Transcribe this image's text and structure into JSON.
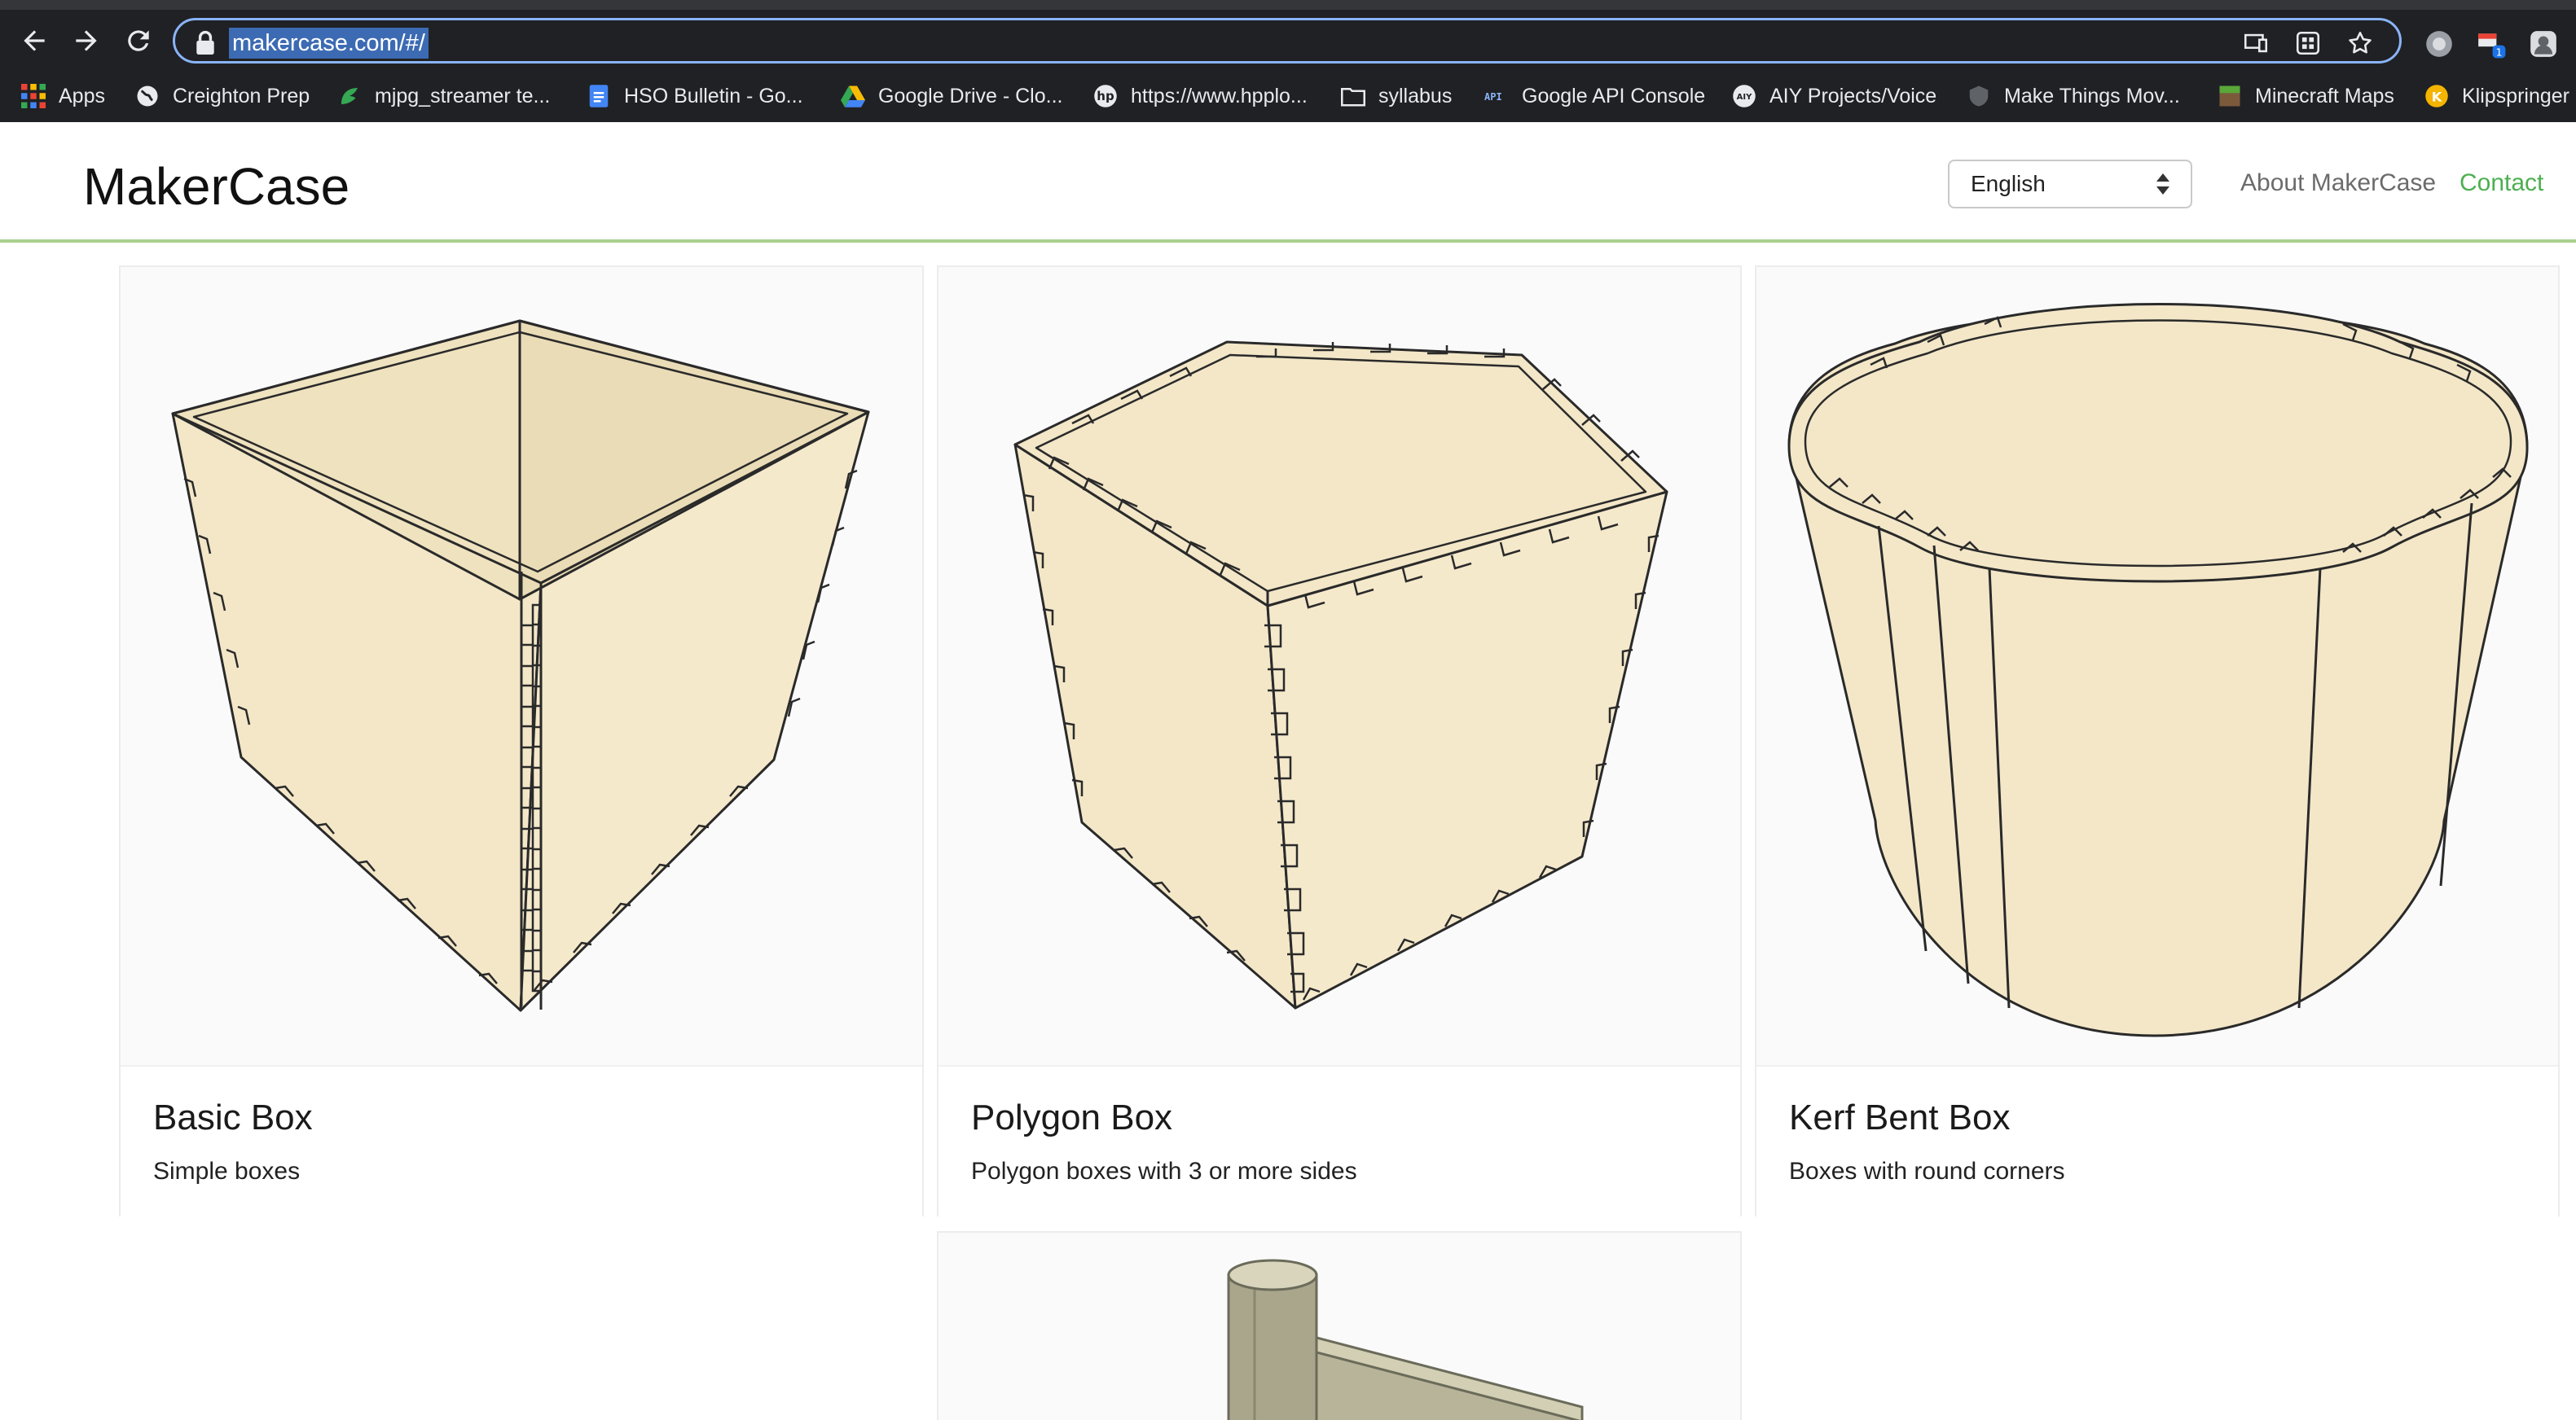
{
  "browser": {
    "url": "makercase.com/#/",
    "bookmarks": [
      {
        "label": "Apps",
        "icon": "apps-grid-icon"
      },
      {
        "label": "Creighton Prep",
        "icon": "globe-icon"
      },
      {
        "label": "mjpg_streamer te...",
        "icon": "leaf-icon"
      },
      {
        "label": "HSO Bulletin - Go...",
        "icon": "docs-icon"
      },
      {
        "label": "Google Drive - Clo...",
        "icon": "drive-icon"
      },
      {
        "label": "https://www.hpplo...",
        "icon": "hp-icon"
      },
      {
        "label": "syllabus",
        "icon": "folder-icon"
      },
      {
        "label": "Google API Console",
        "icon": "api-icon"
      },
      {
        "label": "AIY Projects/Voice",
        "icon": "aiy-icon"
      },
      {
        "label": "Make Things Mov...",
        "icon": "shield-icon"
      },
      {
        "label": "Minecraft Maps",
        "icon": "minecraft-icon"
      },
      {
        "label": "Klipspringer",
        "icon": "k-icon"
      }
    ],
    "extension_badge": "1",
    "k_icon_letter": "K"
  },
  "site": {
    "brand": "MakerCase",
    "language": {
      "selected": "English"
    },
    "nav": {
      "about": "About MakerCase",
      "contact": "Contact"
    }
  },
  "cards": [
    {
      "title": "Basic Box",
      "description": "Simple boxes"
    },
    {
      "title": "Polygon Box",
      "description": "Polygon boxes with 3 or more sides"
    },
    {
      "title": "Kerf Bent Box",
      "description": "Boxes with round corners"
    },
    {
      "title": "",
      "description": ""
    }
  ],
  "colors": {
    "wood": "#f3e7c8",
    "accent_green": "#4caf50",
    "header_line": "#a9d18e",
    "chrome_bg": "#202124",
    "focus_ring": "#8ab4f8"
  }
}
